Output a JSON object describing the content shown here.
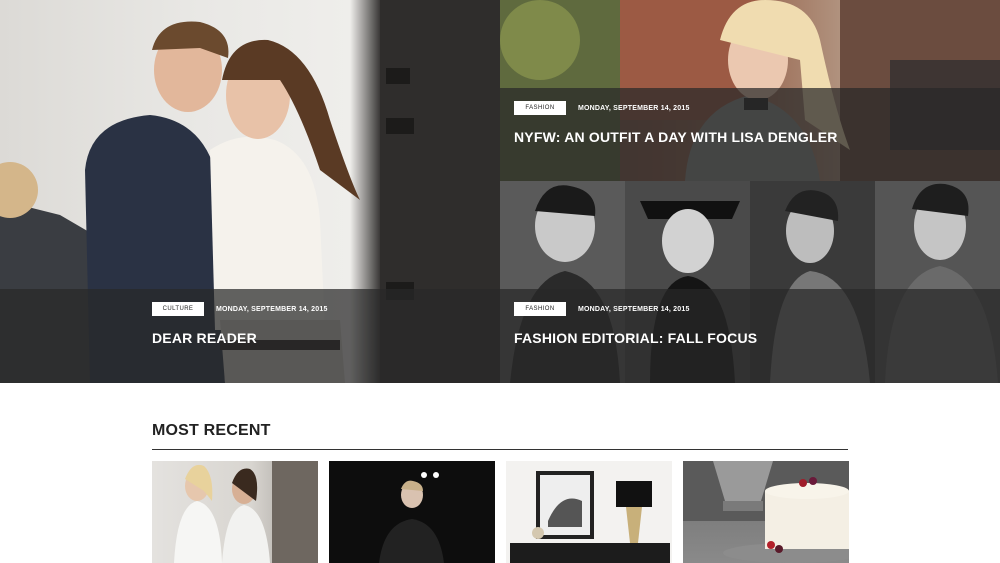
{
  "hero": {
    "main": {
      "category": "CULTURE",
      "date": "MONDAY, SEPTEMBER 14, 2015",
      "title": "DEAR READER"
    },
    "top_right": {
      "category": "FASHION",
      "date": "MONDAY, SEPTEMBER 14, 2015",
      "title": "NYFW: AN OUTFIT A DAY WITH LISA DENGLER"
    },
    "bottom_right": {
      "category": "FASHION",
      "date": "MONDAY, SEPTEMBER 14, 2015",
      "title": "FASHION EDITORIAL: FALL FOCUS"
    }
  },
  "most_recent": {
    "heading": "MOST RECENT"
  },
  "colors": {
    "overlay": "#282828",
    "badge_bg": "#ffffff",
    "heading": "#222222"
  }
}
